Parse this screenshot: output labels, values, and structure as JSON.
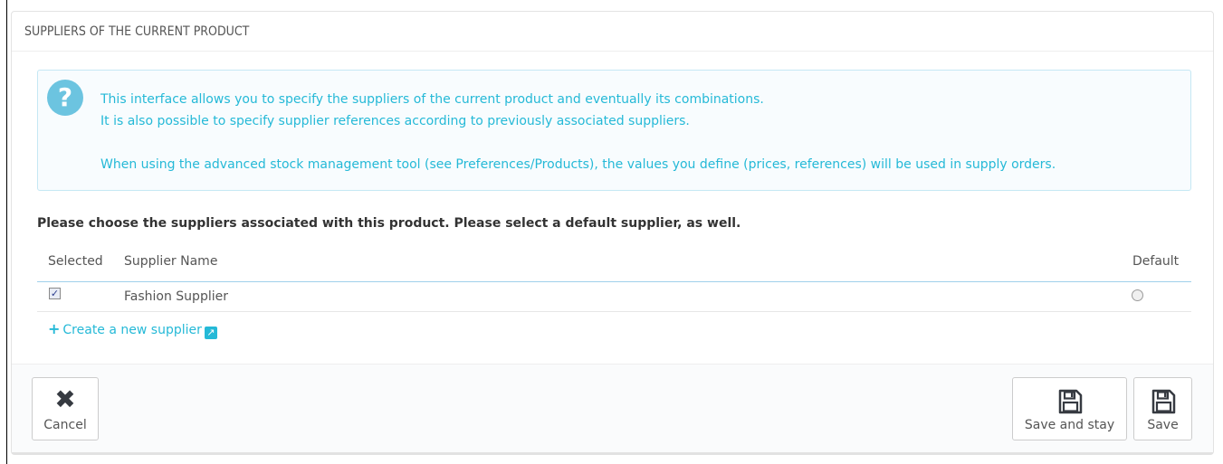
{
  "panel": {
    "title": "SUPPLIERS OF THE CURRENT PRODUCT"
  },
  "alert": {
    "icon": "question-circle-icon",
    "line1": "This interface allows you to specify the suppliers of the current product and eventually its combinations.",
    "line2": "It is also possible to specify supplier references according to previously associated suppliers.",
    "line3": "When using the advanced stock management tool (see Preferences/Products), the values you define (prices, references) will be used in supply orders."
  },
  "instructions": "Please choose the suppliers associated with this product. Please select a default supplier, as well.",
  "table": {
    "headers": {
      "selected": "Selected",
      "name": "Supplier Name",
      "default": "Default"
    },
    "rows": [
      {
        "selected": true,
        "name": "Fashion Supplier",
        "default": false
      }
    ]
  },
  "create_link": {
    "label": "Create a new supplier",
    "icon": "plus-icon",
    "ext_icon": "external-link-icon"
  },
  "footer": {
    "cancel_label": "Cancel",
    "save_and_stay_label": "Save and stay",
    "save_label": "Save"
  },
  "colors": {
    "accent": "#25b9d7",
    "alert_bg": "#f8fcfe",
    "alert_border": "#c5e8f4"
  }
}
